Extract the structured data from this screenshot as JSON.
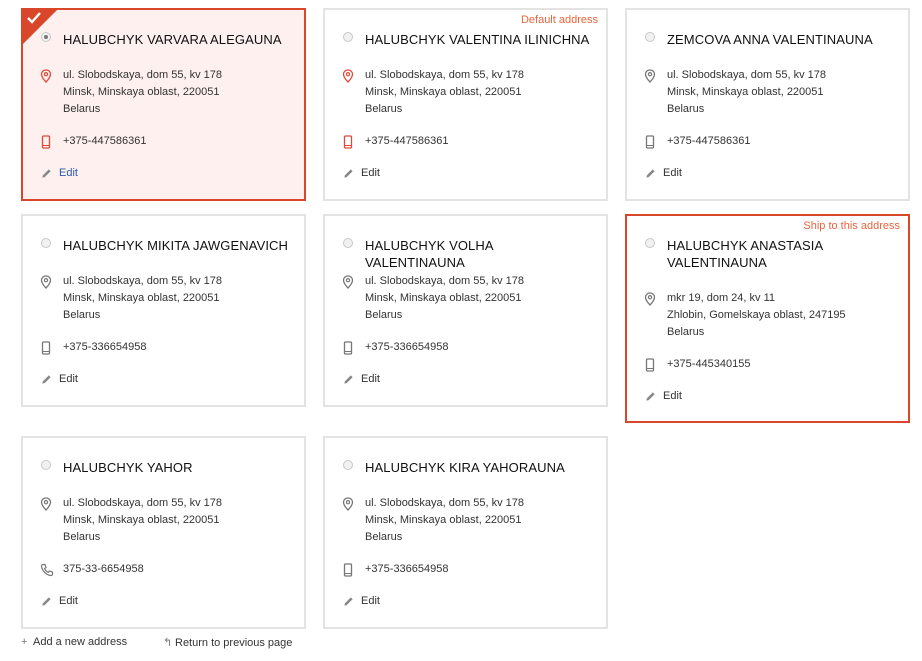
{
  "colors": {
    "accent": "#d8472a",
    "tag": "#e8643e",
    "link": "#2a5db0",
    "border": "#e3e3e3"
  },
  "cards": [
    {
      "name": "HALUBCHYK VARVARA ALEGAUNA",
      "street": "ul. Slobodskaya, dom 55, kv 178",
      "city": "Minsk, Minskaya oblast, 220051",
      "country": "Belarus",
      "phone": "+375-447586361",
      "edit": "Edit",
      "tag": ""
    },
    {
      "name": "HALUBCHYK VALENTINA ILINICHNA",
      "street": "ul. Slobodskaya, dom 55, kv 178",
      "city": "Minsk, Minskaya oblast, 220051",
      "country": "Belarus",
      "phone": "+375-447586361",
      "edit": "Edit",
      "tag": "Default address"
    },
    {
      "name": "ZEMCOVA ANNA VALENTINAUNA",
      "street": "ul. Slobodskaya, dom 55, kv 178",
      "city": "Minsk, Minskaya oblast, 220051",
      "country": "Belarus",
      "phone": "+375-447586361",
      "edit": "Edit",
      "tag": ""
    },
    {
      "name": "HALUBCHYK MIKITA JAWGENAVICH",
      "street": "ul. Slobodskaya, dom 55, kv 178",
      "city": "Minsk, Minskaya oblast, 220051",
      "country": "Belarus",
      "phone": "+375-336654958",
      "edit": "Edit",
      "tag": ""
    },
    {
      "name": "HALUBCHYK VOLHA VALENTINAUNA",
      "street": "ul. Slobodskaya, dom 55, kv 178",
      "city": "Minsk, Minskaya oblast, 220051",
      "country": "Belarus",
      "phone": "+375-336654958",
      "edit": "Edit",
      "tag": ""
    },
    {
      "name_line1": "HALUBCHYK ANASTASIA",
      "name_line2": "VALENTINAUNA",
      "street": "mkr 19, dom 24, kv 11",
      "city": "Zhlobin, Gomelskaya oblast, 247195",
      "country": "Belarus",
      "phone": "+375-445340155",
      "edit": "Edit",
      "tag": "Ship to this address"
    },
    {
      "name": "HALUBCHYK YAHOR",
      "street": "ul. Slobodskaya, dom 55, kv 178",
      "city": "Minsk, Minskaya oblast, 220051",
      "country": "Belarus",
      "phone": "375-33-6654958",
      "edit": "Edit",
      "tag": ""
    },
    {
      "name": "HALUBCHYK KIRA YAHORAUNA",
      "street": "ul. Slobodskaya, dom 55, kv 178",
      "city": "Minsk, Minskaya oblast, 220051",
      "country": "Belarus",
      "phone": "+375-336654958",
      "edit": "Edit",
      "tag": ""
    }
  ],
  "footer": {
    "add_label": "Add a new address",
    "return_label": "Return to previous page"
  }
}
